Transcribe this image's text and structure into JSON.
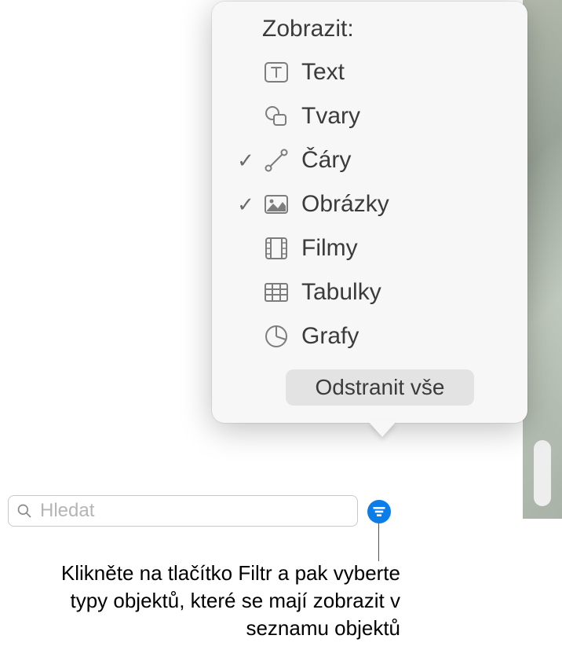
{
  "popover": {
    "header": "Zobrazit:",
    "items": [
      {
        "label": "Text",
        "checked": false,
        "icon": "text-icon"
      },
      {
        "label": "Tvary",
        "checked": false,
        "icon": "shapes-icon"
      },
      {
        "label": "Čáry",
        "checked": true,
        "icon": "lines-icon"
      },
      {
        "label": "Obrázky",
        "checked": true,
        "icon": "images-icon"
      },
      {
        "label": "Filmy",
        "checked": false,
        "icon": "movies-icon"
      },
      {
        "label": "Tabulky",
        "checked": false,
        "icon": "tables-icon"
      },
      {
        "label": "Grafy",
        "checked": false,
        "icon": "charts-icon"
      }
    ],
    "clear_label": "Odstranit vše"
  },
  "search": {
    "placeholder": "Hledat"
  },
  "caption": "Klikněte na tlačítko Filtr a pak vyberte typy objektů, které se mají zobrazit v seznamu objektů"
}
